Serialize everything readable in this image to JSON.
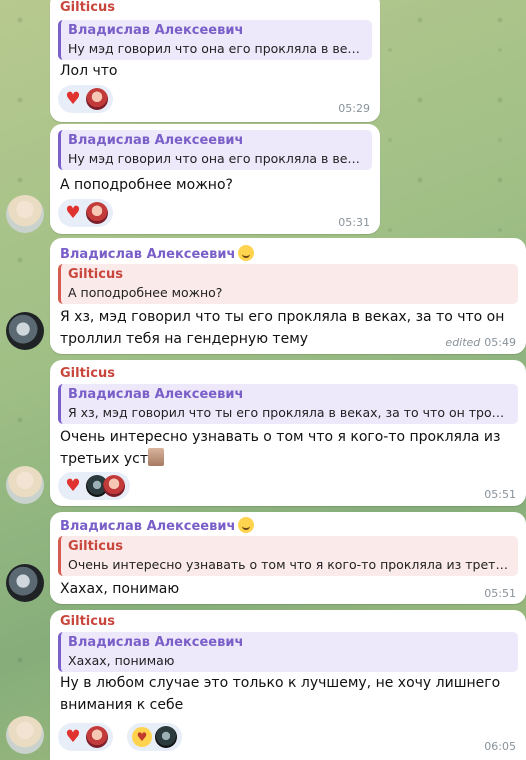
{
  "messages": [
    {
      "sender": "Gilticus",
      "reply": {
        "name": "Владислав Алексеевич",
        "text": "Ну мэд говорил что она его прокляла в веках"
      },
      "text": "Лол что",
      "time": "05:29"
    },
    {
      "reply": {
        "name": "Владислав Алексеевич",
        "text": "Ну мэд говорил что она его прокляла в веках"
      },
      "text": "А поподробнее можно?",
      "time": "05:31"
    },
    {
      "sender": "Владислав Алексеевич",
      "reply": {
        "name": "Gilticus",
        "text": "А поподробнее можно?"
      },
      "text_line1": "Я хз, мэд говорил что ты его прокляла в веках, за то что он",
      "text_line2": "троллил тебя на гендерную тему",
      "edited": "edited",
      "time": "05:49"
    },
    {
      "sender": "Gilticus",
      "reply": {
        "name": "Владислав Алексеевич",
        "text": "Я хз, мэд говорил что ты его прокляла в веках, за то что он тролли..."
      },
      "text_line1": "Очень интересно узнавать о том что я кого-то прокляла из",
      "text_line2": "третьих уст",
      "time": "05:51"
    },
    {
      "sender": "Владислав Алексеевич",
      "reply": {
        "name": "Gilticus",
        "text": "Очень интересно узнавать о том что я кого-то прокляла из третьи..."
      },
      "text": "Хахах, понимаю",
      "time": "05:51"
    },
    {
      "sender": "Gilticus",
      "reply": {
        "name": "Владислав Алексеевич",
        "text": "Хахах, понимаю"
      },
      "text_line1": "Ну в любом случае это только к лучшему, не хочу лишнего",
      "text_line2": "внимания к себе",
      "time": "06:05"
    }
  ],
  "icons": {
    "heart": "♥"
  }
}
